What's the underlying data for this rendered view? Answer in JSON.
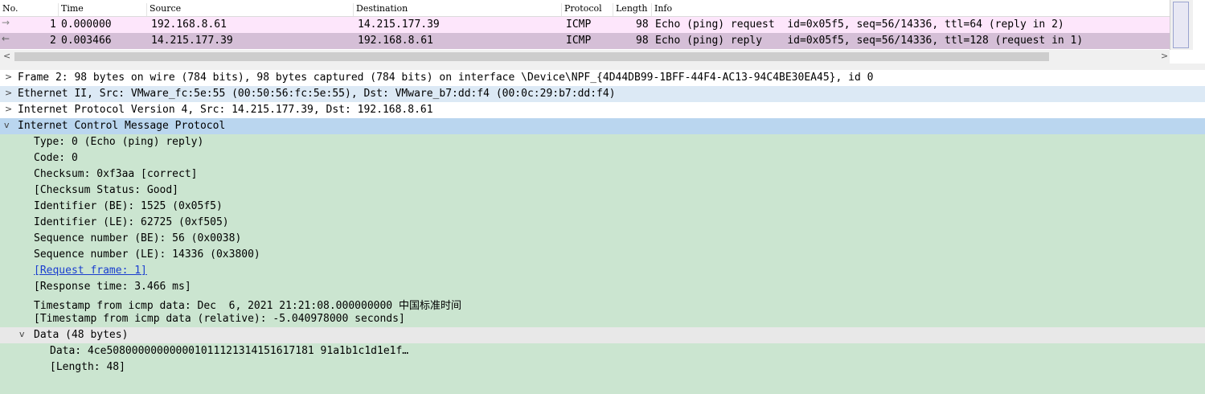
{
  "packet_list": {
    "columns": [
      "No.",
      "Time",
      "Source",
      "Destination",
      "Protocol",
      "Length",
      "Info"
    ],
    "rows": [
      {
        "no": "1",
        "time": "0.000000",
        "source": "192.168.8.61",
        "destination": "14.215.177.39",
        "protocol": "ICMP",
        "length": "98",
        "info": "Echo (ping) request  id=0x05f5, seq=56/14336, ttl=64 (reply in 2)",
        "color": "#fde6fb"
      },
      {
        "no": "2",
        "time": "0.003466",
        "source": "14.215.177.39",
        "destination": "192.168.8.61",
        "protocol": "ICMP",
        "length": "98",
        "info": "Echo (ping) reply    id=0x05f5, seq=56/14336, ttl=128 (request in 1)",
        "color": "#d5bfd7"
      }
    ],
    "scroll_left": "<",
    "scroll_right": ">"
  },
  "details": {
    "frame": "Frame 2: 98 bytes on wire (784 bits), 98 bytes captured (784 bits) on interface \\Device\\NPF_{4D44DB99-1BFF-44F4-AC13-94C4BE30EA45}, id 0",
    "ethernet": "Ethernet II, Src: VMware_fc:5e:55 (00:50:56:fc:5e:55), Dst: VMware_b7:dd:f4 (00:0c:29:b7:dd:f4)",
    "ip": "Internet Protocol Version 4, Src: 14.215.177.39, Dst: 192.168.8.61",
    "icmp": "Internet Control Message Protocol",
    "icmp_fields": {
      "type": "Type: 0 (Echo (ping) reply)",
      "code": "Code: 0",
      "checksum": "Checksum: 0xf3aa [correct]",
      "checksum_status": "[Checksum Status: Good]",
      "id_be": "Identifier (BE): 1525 (0x05f5)",
      "id_le": "Identifier (LE): 62725 (0xf505)",
      "seq_be": "Sequence number (BE): 56 (0x0038)",
      "seq_le": "Sequence number (LE): 14336 (0x3800)",
      "request_frame": "[Request frame: 1]",
      "response_time": "[Response time: 3.466 ms]",
      "timestamp": "Timestamp from icmp data: Dec  6, 2021 21:21:08.000000000 中国标准时间",
      "timestamp_rel": "[Timestamp from icmp data (relative): -5.040978000 seconds]"
    },
    "data": "Data (48 bytes)",
    "data_fields": {
      "data": "Data: 4ce508000000000001011121314151617181 91a1b1c1d1e1f…",
      "length": "[Length: 48]"
    },
    "collapsed_glyph": ">",
    "expanded_glyph": "v"
  }
}
